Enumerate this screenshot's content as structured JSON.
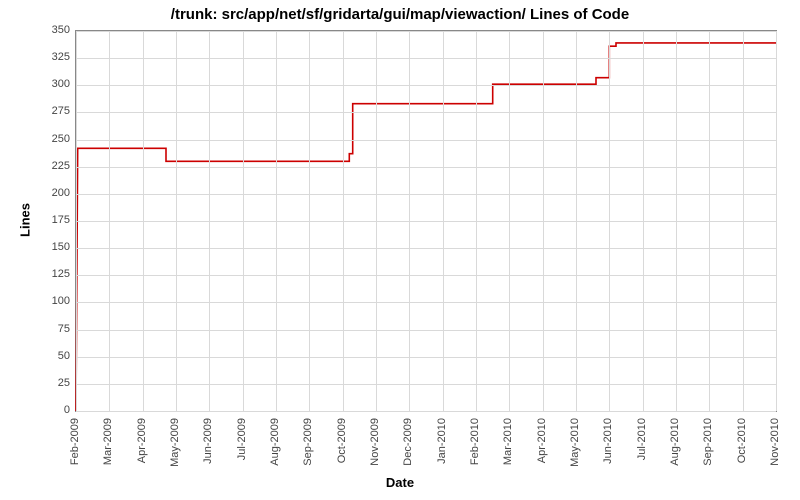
{
  "chart_data": {
    "type": "line",
    "title": "/trunk: src/app/net/sf/gridarta/gui/map/viewaction/ Lines of Code",
    "xlabel": "Date",
    "ylabel": "Lines",
    "ylim": [
      0,
      350
    ],
    "yticks": [
      0,
      25,
      50,
      75,
      100,
      125,
      150,
      175,
      200,
      225,
      250,
      275,
      300,
      325,
      350
    ],
    "categories": [
      "Feb-2009",
      "Mar-2009",
      "Apr-2009",
      "May-2009",
      "Jun-2009",
      "Jul-2009",
      "Aug-2009",
      "Sep-2009",
      "Oct-2009",
      "Nov-2009",
      "Dec-2009",
      "Jan-2010",
      "Feb-2010",
      "Mar-2010",
      "Apr-2010",
      "May-2010",
      "Jun-2010",
      "Jul-2010",
      "Aug-2010",
      "Sep-2010",
      "Oct-2010",
      "Nov-2010"
    ],
    "series": [
      {
        "name": "Lines of Code",
        "color": "#cc0000",
        "points": [
          {
            "x": "Feb-2009",
            "y": 0
          },
          {
            "x": "Feb-2009",
            "y": 242
          },
          {
            "x": "Apr-2009",
            "y": 242
          },
          {
            "x": "Apr-2009",
            "y": 230
          },
          {
            "x": "Oct-2009",
            "y": 230
          },
          {
            "x": "Oct-2009",
            "y": 237
          },
          {
            "x": "Oct-2009",
            "y": 283
          },
          {
            "x": "Feb-2010",
            "y": 283
          },
          {
            "x": "Feb-2010",
            "y": 301
          },
          {
            "x": "May-2010",
            "y": 301
          },
          {
            "x": "May-2010",
            "y": 307
          },
          {
            "x": "Jun-2010",
            "y": 307
          },
          {
            "x": "Jun-2010",
            "y": 336
          },
          {
            "x": "Jun-2010",
            "y": 339
          },
          {
            "x": "Nov-2010",
            "y": 339
          }
        ]
      }
    ],
    "extra_steps": {
      "apr2009_frac": 0.7,
      "oct2009_frac": 0.2,
      "feb2010_frac": 0.5,
      "may2010_frac": 0.6,
      "jun2010_frac": 0.0,
      "jun2010b_frac": 0.2
    }
  }
}
